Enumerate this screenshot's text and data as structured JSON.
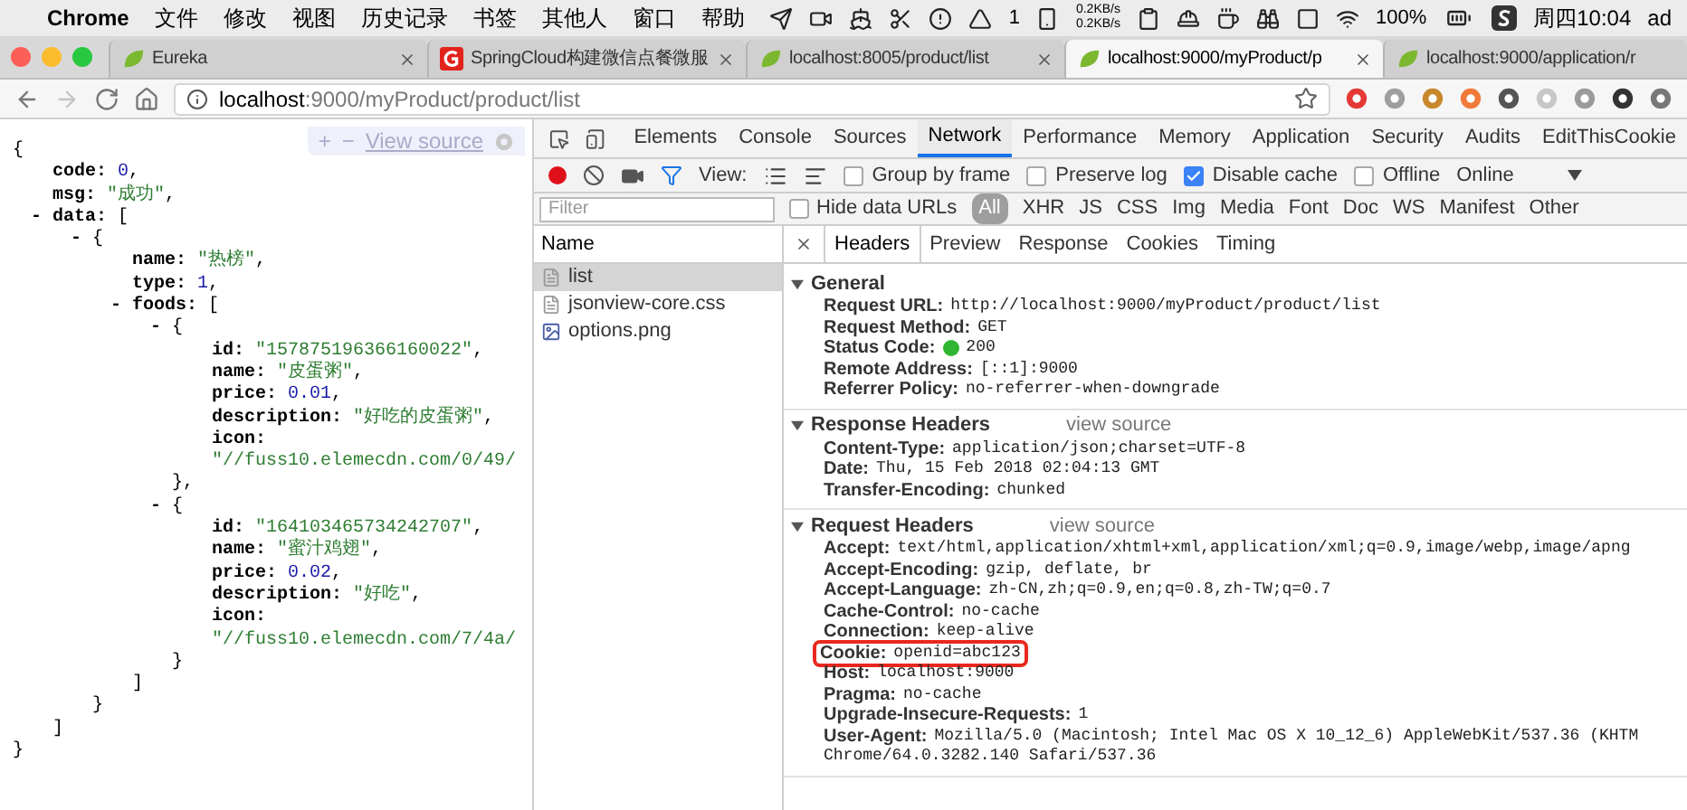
{
  "menubar": {
    "app": "Chrome",
    "menus": [
      "文件",
      "修改",
      "视图",
      "历史记录",
      "书签",
      "其他人",
      "窗口",
      "帮助"
    ],
    "badge": "1",
    "net_up": "0.2KB/s",
    "net_down": "0.2KB/s",
    "battery": "100%",
    "clock": "周四10:04",
    "user": "ad"
  },
  "tabs": [
    {
      "title": "Eureka",
      "kind": "leaf",
      "selected": false,
      "closable": true
    },
    {
      "title": "SpringCloud构建微信点餐微服",
      "kind": "brand",
      "selected": false,
      "closable": true
    },
    {
      "title": "localhost:8005/product/list",
      "kind": "leaf",
      "selected": false,
      "closable": true
    },
    {
      "title": "localhost:9000/myProduct/p",
      "kind": "leaf",
      "selected": true,
      "closable": true
    },
    {
      "title": "localhost:9000/application/r",
      "kind": "leaf",
      "selected": false,
      "closable": false
    }
  ],
  "address": {
    "host": "localhost",
    "path": ":9000/myProduct/product/list"
  },
  "json_view": {
    "controls": {
      "expand": "+",
      "collapse": "−",
      "view_source": "View source"
    },
    "root": {
      "kind": "branch",
      "open": "{",
      "close": "}",
      "children": [
        {
          "kind": "pair",
          "key": "code:",
          "value": {
            "kind": "number",
            "text": "0"
          },
          "suffix": ","
        },
        {
          "kind": "pair",
          "key": "msg:",
          "value": {
            "kind": "string",
            "text": "\"成功\""
          },
          "suffix": ","
        },
        {
          "kind": "branch",
          "toggle": "-",
          "key": "data:",
          "open": "[",
          "close": "]",
          "children": [
            {
              "kind": "branch",
              "toggle": "-",
              "open": "{",
              "close": "}",
              "children": [
                {
                  "kind": "pair",
                  "key": "name:",
                  "value": {
                    "kind": "string",
                    "text": "\"热榜\""
                  },
                  "suffix": ","
                },
                {
                  "kind": "pair",
                  "key": "type:",
                  "value": {
                    "kind": "number",
                    "text": "1"
                  },
                  "suffix": ","
                },
                {
                  "kind": "branch",
                  "toggle": "-",
                  "key": "foods:",
                  "open": "[",
                  "close": "]",
                  "children": [
                    {
                      "kind": "branch",
                      "toggle": "-",
                      "open": "{",
                      "close": "},",
                      "children": [
                        {
                          "kind": "pair",
                          "key": "id:",
                          "value": {
                            "kind": "string",
                            "text": "\"157875196366160022\""
                          },
                          "suffix": ","
                        },
                        {
                          "kind": "pair",
                          "key": "name:",
                          "value": {
                            "kind": "string",
                            "text": "\"皮蛋粥\""
                          },
                          "suffix": ","
                        },
                        {
                          "kind": "pair",
                          "key": "price:",
                          "value": {
                            "kind": "number",
                            "text": "0.01"
                          },
                          "suffix": ","
                        },
                        {
                          "kind": "pair",
                          "key": "description:",
                          "value": {
                            "kind": "string",
                            "text": "\"好吃的皮蛋粥\""
                          },
                          "suffix": ","
                        },
                        {
                          "kind": "wrapped",
                          "key": "icon:",
                          "value": {
                            "kind": "string",
                            "text": "\"//fuss10.elemecdn.com/0/49/"
                          }
                        }
                      ]
                    },
                    {
                      "kind": "branch",
                      "toggle": "-",
                      "open": "{",
                      "close": "}",
                      "children": [
                        {
                          "kind": "pair",
                          "key": "id:",
                          "value": {
                            "kind": "string",
                            "text": "\"164103465734242707\""
                          },
                          "suffix": ","
                        },
                        {
                          "kind": "pair",
                          "key": "name:",
                          "value": {
                            "kind": "string",
                            "text": "\"蜜汁鸡翅\""
                          },
                          "suffix": ","
                        },
                        {
                          "kind": "pair",
                          "key": "price:",
                          "value": {
                            "kind": "number",
                            "text": "0.02"
                          },
                          "suffix": ","
                        },
                        {
                          "kind": "pair",
                          "key": "description:",
                          "value": {
                            "kind": "string",
                            "text": "\"好吃\""
                          },
                          "suffix": ","
                        },
                        {
                          "kind": "wrapped",
                          "key": "icon:",
                          "value": {
                            "kind": "string",
                            "text": "\"//fuss10.elemecdn.com/7/4a/"
                          }
                        }
                      ]
                    }
                  ]
                }
              ]
            }
          ]
        }
      ]
    }
  },
  "devtools": {
    "panels": [
      {
        "label": "Elements",
        "selected": false
      },
      {
        "label": "Console",
        "selected": false
      },
      {
        "label": "Sources",
        "selected": false
      },
      {
        "label": "Network",
        "selected": true
      },
      {
        "label": "Performance",
        "selected": false
      },
      {
        "label": "Memory",
        "selected": false
      },
      {
        "label": "Application",
        "selected": false
      },
      {
        "label": "Security",
        "selected": false
      },
      {
        "label": "Audits",
        "selected": false
      },
      {
        "label": "EditThisCookie",
        "selected": false
      }
    ],
    "view_label": "View:",
    "options": [
      {
        "label": "Group by frame",
        "checked": false
      },
      {
        "label": "Preserve log",
        "checked": false
      },
      {
        "label": "Disable cache",
        "checked": true
      },
      {
        "label": "Offline",
        "checked": false
      }
    ],
    "throttle": "Online",
    "filter": {
      "placeholder": "Filter",
      "hide_data_urls": {
        "label": "Hide data URLs",
        "checked": false
      },
      "types": [
        {
          "label": "All",
          "selected": true
        },
        {
          "label": "XHR",
          "selected": false
        },
        {
          "label": "JS",
          "selected": false
        },
        {
          "label": "CSS",
          "selected": false
        },
        {
          "label": "Img",
          "selected": false
        },
        {
          "label": "Media",
          "selected": false
        },
        {
          "label": "Font",
          "selected": false
        },
        {
          "label": "Doc",
          "selected": false
        },
        {
          "label": "WS",
          "selected": false
        },
        {
          "label": "Manifest",
          "selected": false
        },
        {
          "label": "Other",
          "selected": false
        }
      ]
    },
    "requests": {
      "header": "Name",
      "items": [
        {
          "name": "list",
          "kind": "document",
          "selected": true
        },
        {
          "name": "jsonview-core.css",
          "kind": "document",
          "selected": false
        },
        {
          "name": "options.png",
          "kind": "image",
          "selected": false
        }
      ]
    },
    "detail_tabs": [
      {
        "label": "Headers",
        "selected": true
      },
      {
        "label": "Preview",
        "selected": false
      },
      {
        "label": "Response",
        "selected": false
      },
      {
        "label": "Cookies",
        "selected": false
      },
      {
        "label": "Timing",
        "selected": false
      }
    ],
    "sections": [
      {
        "title": "General",
        "expanded": true,
        "rows": [
          {
            "name": "Request URL:",
            "value": "http://localhost:9000/myProduct/product/list",
            "kind": "plain",
            "highlighted": false
          },
          {
            "name": "Request Method:",
            "value": "GET",
            "kind": "plain",
            "highlighted": false
          },
          {
            "name": "Status Code:",
            "value": "200",
            "kind": "status",
            "highlighted": false
          },
          {
            "name": "Remote Address:",
            "value": "[::1]:9000",
            "kind": "plain",
            "highlighted": false
          },
          {
            "name": "Referrer Policy:",
            "value": "no-referrer-when-downgrade",
            "kind": "plain",
            "highlighted": false
          }
        ]
      },
      {
        "title": "Response Headers",
        "view_source": "view source",
        "expanded": true,
        "rows": [
          {
            "name": "Content-Type:",
            "value": "application/json;charset=UTF-8",
            "kind": "plain",
            "highlighted": false
          },
          {
            "name": "Date:",
            "value": "Thu, 15 Feb 2018 02:04:13 GMT",
            "kind": "plain",
            "highlighted": false
          },
          {
            "name": "Transfer-Encoding:",
            "value": "chunked",
            "kind": "plain",
            "highlighted": false
          }
        ]
      },
      {
        "title": "Request Headers",
        "view_source": "view source",
        "expanded": true,
        "rows": [
          {
            "name": "Accept:",
            "value": "text/html,application/xhtml+xml,application/xml;q=0.9,image/webp,image/apng",
            "kind": "plain",
            "highlighted": false
          },
          {
            "name": "Accept-Encoding:",
            "value": "gzip, deflate, br",
            "kind": "plain",
            "highlighted": false
          },
          {
            "name": "Accept-Language:",
            "value": "zh-CN,zh;q=0.9,en;q=0.8,zh-TW;q=0.7",
            "kind": "plain",
            "highlighted": false
          },
          {
            "name": "Cache-Control:",
            "value": "no-cache",
            "kind": "plain",
            "highlighted": false
          },
          {
            "name": "Connection:",
            "value": "keep-alive",
            "kind": "plain",
            "highlighted": false
          },
          {
            "name": "Cookie:",
            "value": "openid=abc123",
            "kind": "plain",
            "highlighted": true
          },
          {
            "name": "Host:",
            "value": "localhost:9000",
            "kind": "plain",
            "highlighted": false
          },
          {
            "name": "Pragma:",
            "value": "no-cache",
            "kind": "plain",
            "highlighted": false
          },
          {
            "name": "Upgrade-Insecure-Requests:",
            "value": "1",
            "kind": "plain",
            "highlighted": false
          },
          {
            "name": "User-Agent:",
            "value": "Mozilla/5.0 (Macintosh; Intel Mac OS X 10_12_6) AppleWebKit/537.36 (KHTM",
            "continuation": "Chrome/64.0.3282.140 Safari/537.36",
            "kind": "plain",
            "highlighted": false
          }
        ]
      }
    ]
  }
}
